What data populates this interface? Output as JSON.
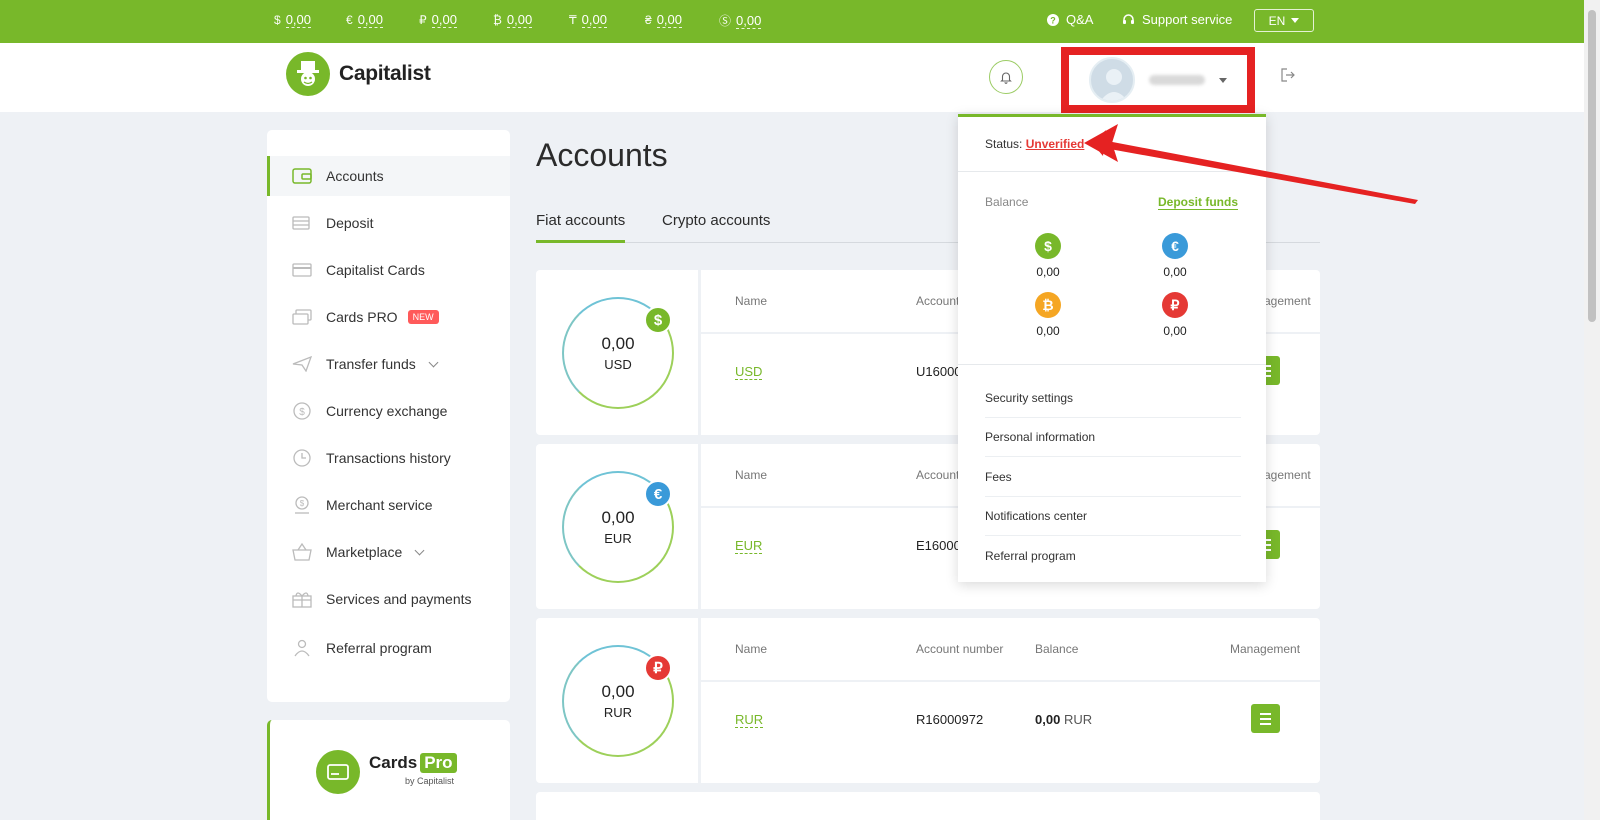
{
  "topbar": {
    "currencies": [
      {
        "symbol": "$",
        "value": "0,00"
      },
      {
        "symbol": "€",
        "value": "0,00"
      },
      {
        "symbol": "₽",
        "value": "0,00"
      },
      {
        "symbol": "₿",
        "value": "0,00"
      },
      {
        "symbol": "₸",
        "value": "0,00"
      },
      {
        "symbol": "₴",
        "value": "0,00"
      },
      {
        "symbol": "Ⓢ",
        "value": "0,00"
      }
    ],
    "qa": "Q&A",
    "support": "Support service",
    "lang": "EN"
  },
  "header": {
    "logo": "Capitalist"
  },
  "sidebar": {
    "items": [
      {
        "label": "Accounts",
        "icon": "wallet-icon"
      },
      {
        "label": "Deposit",
        "icon": "deposit-icon"
      },
      {
        "label": "Capitalist Cards",
        "icon": "card-icon"
      },
      {
        "label": "Cards PRO",
        "icon": "cards-pro-icon",
        "badge": "NEW"
      },
      {
        "label": "Transfer funds",
        "icon": "paper-plane-icon"
      },
      {
        "label": "Currency exchange",
        "icon": "exchange-icon"
      },
      {
        "label": "Transactions history",
        "icon": "clock-icon"
      },
      {
        "label": "Merchant service",
        "icon": "merchant-icon"
      },
      {
        "label": "Marketplace",
        "icon": "basket-icon"
      },
      {
        "label": "Services and payments",
        "icon": "gift-icon"
      },
      {
        "label": "Referral program",
        "icon": "referral-icon"
      }
    ],
    "promo": {
      "title": "Cards",
      "pro": "Pro",
      "by": "by Capitalist"
    }
  },
  "main": {
    "title": "Accounts",
    "tabs": [
      "Fiat accounts",
      "Crypto accounts"
    ],
    "columns": [
      "Name",
      "Account number",
      "Balance",
      "Management"
    ],
    "accounts": [
      {
        "amount": "0,00",
        "code": "USD",
        "symbol": "$",
        "color": "#78b82a",
        "name": "USD",
        "number": "U16000",
        "balance": ""
      },
      {
        "amount": "0,00",
        "code": "EUR",
        "symbol": "€",
        "color": "#3a9ad9",
        "name": "EUR",
        "number": "E16000",
        "balance": ""
      },
      {
        "amount": "0,00",
        "code": "RUR",
        "symbol": "₽",
        "color": "#e53935",
        "name": "RUR",
        "number": "R16000972",
        "balance": "0,00",
        "balance_unit": "RUR"
      }
    ],
    "truncated_column": "Account",
    "truncated_management": "agement"
  },
  "dropdown": {
    "status_label": "Status:",
    "status_value": "Unverified",
    "balance_label": "Balance",
    "deposit_link": "Deposit funds",
    "coins": [
      {
        "symbol": "$",
        "value": "0,00",
        "color": "#78b82a"
      },
      {
        "symbol": "€",
        "value": "0,00",
        "color": "#3a9ad9"
      },
      {
        "symbol": "₿",
        "value": "0,00",
        "color": "#f5a623"
      },
      {
        "symbol": "₽",
        "value": "0,00",
        "color": "#e53935"
      }
    ],
    "menu": [
      "Security settings",
      "Personal information",
      "Fees",
      "Notifications center",
      "Referral program"
    ]
  },
  "annotation": {
    "highlight_color": "#e52222"
  }
}
